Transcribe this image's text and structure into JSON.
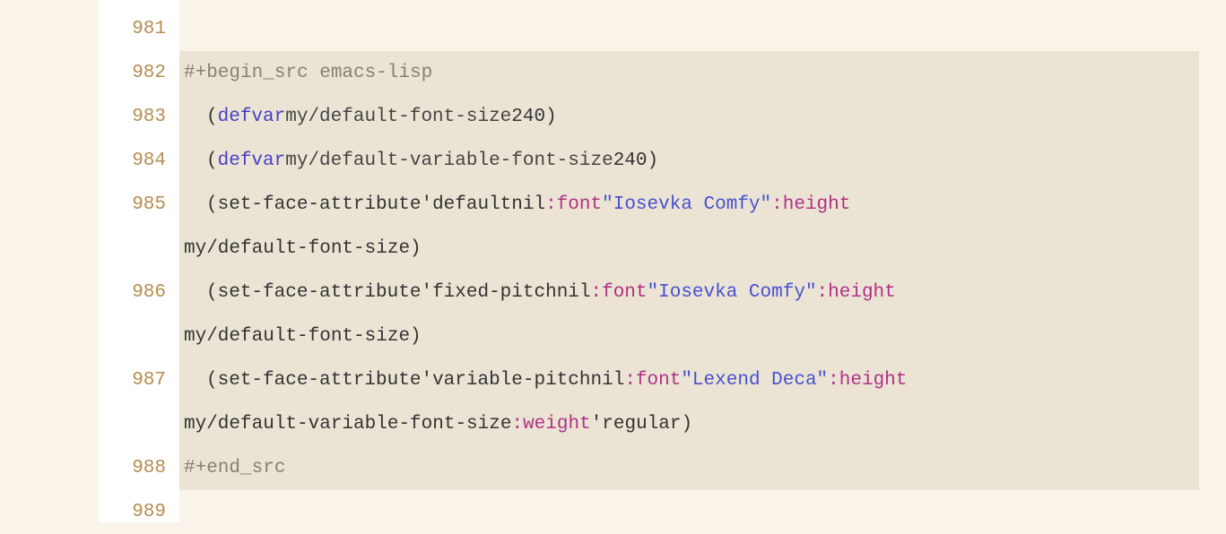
{
  "gutter": {
    "line_981": "981",
    "line_982": "982",
    "line_983": "983",
    "line_984": "984",
    "line_985": "985",
    "line_986": "986",
    "line_987": "987",
    "line_988": "988",
    "line_989": "989"
  },
  "code": {
    "begin_src": "#+begin_src emacs-lisp",
    "end_src": "#+end_src",
    "lparen": "(",
    "rparen": ")",
    "defvar": "defvar",
    "space": " ",
    "quote": "'",
    "var_default_font_size": "my/default-font-size",
    "var_default_variable_font_size": "my/default-variable-font-size",
    "value_240": "240",
    "fn_set_face_attribute": "set-face-attribute ",
    "face_default": "default",
    "face_fixed_pitch": "fixed-pitch",
    "face_variable_pitch": "variable-pitch",
    "nil": " nil ",
    "attr_font": ":font",
    "attr_height": ":height",
    "attr_weight": ":weight",
    "str_iosevka": "\"Iosevka Comfy\"",
    "str_lexend": "\"Lexend Deca\"",
    "sym_regular": "regular",
    "wrap_985": "my/default-font-size)",
    "wrap_986": "my/default-font-size)",
    "wrap_987": "my/default-variable-font-size "
  }
}
